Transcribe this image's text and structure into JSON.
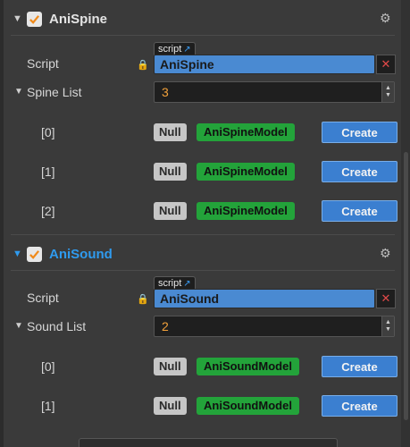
{
  "components": [
    {
      "title": "AniSpine",
      "script_tag": "script",
      "script_label": "Script",
      "script_value": "AniSpine",
      "list_label": "Spine List",
      "list_count": "3",
      "items": [
        {
          "index": "[0]",
          "null": "Null",
          "model": "AniSpineModel",
          "action": "Create"
        },
        {
          "index": "[1]",
          "null": "Null",
          "model": "AniSpineModel",
          "action": "Create"
        },
        {
          "index": "[2]",
          "null": "Null",
          "model": "AniSpineModel",
          "action": "Create"
        }
      ]
    },
    {
      "title": "AniSound",
      "script_tag": "script",
      "script_label": "Script",
      "script_value": "AniSound",
      "list_label": "Sound List",
      "list_count": "2",
      "items": [
        {
          "index": "[0]",
          "null": "Null",
          "model": "AniSoundModel",
          "action": "Create"
        },
        {
          "index": "[1]",
          "null": "Null",
          "model": "AniSoundModel",
          "action": "Create"
        }
      ]
    }
  ],
  "colors": {
    "accent_blue": "#2f9bef",
    "model_green": "#23a33a",
    "create_blue": "#3b7fd0",
    "count_orange": "#f2a13a",
    "remove_red": "#e24949"
  },
  "icons": {
    "collapse": "triangle-down",
    "enabled": "checkmark",
    "settings": "gear",
    "lock": "lock",
    "open_script": "external-link",
    "remove": "x",
    "stepper": "up-down-arrows"
  }
}
